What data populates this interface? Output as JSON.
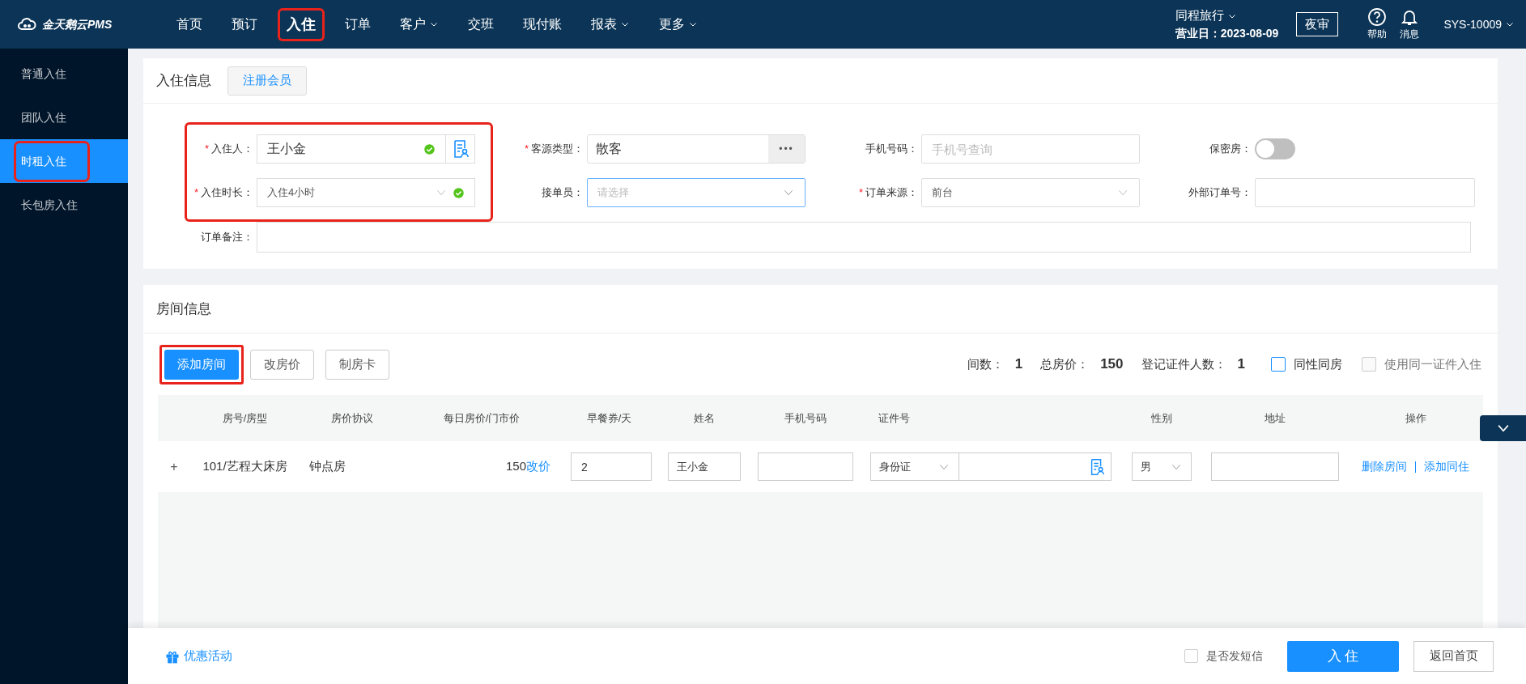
{
  "logo": {
    "text": "金天鹅云PMS"
  },
  "nav": [
    {
      "label": "首页",
      "dropdown": false,
      "selected": false,
      "highlighted": false
    },
    {
      "label": "预订",
      "dropdown": false,
      "selected": false,
      "highlighted": false
    },
    {
      "label": "入住",
      "dropdown": false,
      "selected": true,
      "highlighted": true
    },
    {
      "label": "订单",
      "dropdown": false,
      "selected": false,
      "highlighted": false
    },
    {
      "label": "客户",
      "dropdown": true,
      "selected": false,
      "highlighted": false
    },
    {
      "label": "交班",
      "dropdown": false,
      "selected": false,
      "highlighted": false
    },
    {
      "label": "现付账",
      "dropdown": false,
      "selected": false,
      "highlighted": false
    },
    {
      "label": "报表",
      "dropdown": true,
      "selected": false,
      "highlighted": false
    },
    {
      "label": "更多",
      "dropdown": true,
      "selected": false,
      "highlighted": false
    }
  ],
  "header_right": {
    "hotel": "同程旅行",
    "business_date": "营业日：2023-08-09",
    "night_audit": "夜审",
    "help": "帮助",
    "messages": "消息",
    "user": "SYS-10009"
  },
  "sidebar": {
    "items": [
      {
        "label": "普通入住",
        "selected": false,
        "highlighted": false
      },
      {
        "label": "团队入住",
        "selected": false,
        "highlighted": false
      },
      {
        "label": "时租入住",
        "selected": true,
        "highlighted": true
      },
      {
        "label": "长包房入住",
        "selected": false,
        "highlighted": false
      }
    ]
  },
  "checkin_info": {
    "title": "入住信息",
    "register_button": "注册会员",
    "guest": {
      "label": "入住人：",
      "required_mark": "*",
      "value": "王小金",
      "valid": true
    },
    "duration": {
      "label": "入住时长：",
      "required_mark": "*",
      "value": "入住4小时",
      "valid": true
    },
    "highlighted": true,
    "source_type": {
      "label": "客源类型：",
      "required_mark": "*",
      "value": "散客",
      "more": "•••"
    },
    "receiver": {
      "label": "接单员：",
      "placeholder": "请选择"
    },
    "phone": {
      "label": "手机号码：",
      "placeholder": "手机号查询"
    },
    "order_source": {
      "label": "订单来源：",
      "required_mark": "*",
      "value": "前台"
    },
    "secret_room": {
      "label": "保密房：",
      "on": false
    },
    "external_order": {
      "label": "外部订单号："
    },
    "remark": {
      "label": "订单备注："
    }
  },
  "room_info": {
    "title": "房间信息",
    "buttons": [
      {
        "label": "添加房间",
        "kind": "primary",
        "highlighted": true
      },
      {
        "label": "改房价",
        "kind": "default",
        "highlighted": false
      },
      {
        "label": "制房卡",
        "kind": "default",
        "highlighted": false
      }
    ],
    "summary": [
      {
        "label": "间数：",
        "value": "1"
      },
      {
        "label": "总房价：",
        "value": "150"
      },
      {
        "label": "登记证件人数：",
        "value": "1"
      }
    ],
    "options": [
      {
        "label": "同性同房",
        "checked": false,
        "disabled": false
      },
      {
        "label": "使用同一证件入住",
        "checked": false,
        "disabled": true
      }
    ],
    "columns": [
      "房号/房型",
      "房价协议",
      "每日房价/门市价",
      "早餐券/天",
      "姓名",
      "手机号码",
      "证件号",
      "性别",
      "地址",
      "操作"
    ],
    "rows": [
      {
        "expand": "+",
        "room": "101/艺程大床房",
        "plan": "钟点房",
        "price": "150",
        "change_price": "改价",
        "breakfast": "2",
        "name": "王小金",
        "id_type": "身份证",
        "gender": "男",
        "actions": [
          "删除房间",
          "添加同住"
        ]
      }
    ]
  },
  "footer": {
    "promo": "优惠活动",
    "sms": {
      "label": "是否发短信",
      "checked": false
    },
    "checkin_button": "入 住",
    "home_button": "返回首页"
  }
}
